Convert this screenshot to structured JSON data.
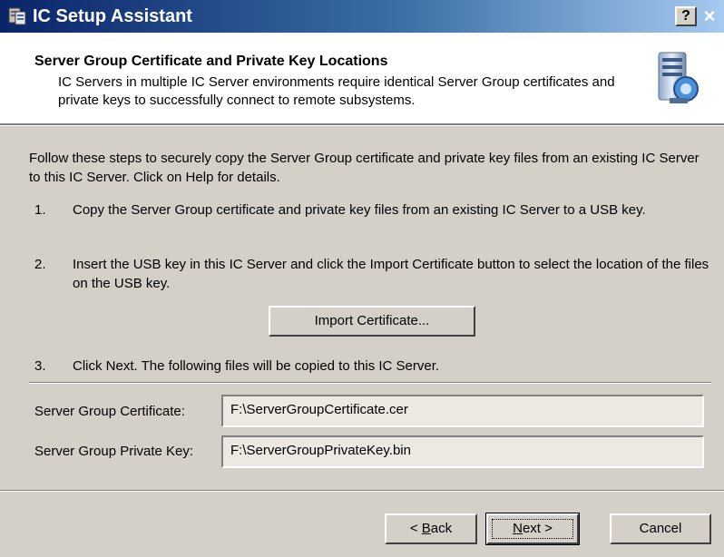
{
  "window": {
    "title": "IC Setup Assistant",
    "help_label": "?",
    "close_label": "×"
  },
  "banner": {
    "title": "Server Group Certificate and Private Key Locations",
    "description": "IC Servers in multiple IC Server environments require identical Server Group certificates and private keys to successfully connect to remote subsystems."
  },
  "content": {
    "intro": "Follow these steps to securely copy the Server Group certificate and private key files from an existing IC Server to this IC Server. Click on Help for details.",
    "steps": [
      {
        "number": "1.",
        "text": "Copy the Server Group certificate and private key files from an existing IC Server to a USB key."
      },
      {
        "number": "2.",
        "text": "Insert the USB key in this IC Server and click the Import Certificate button to select the location of the files on the USB key."
      },
      {
        "number": "3.",
        "text": "Click Next. The following files will be copied to this IC Server."
      }
    ],
    "import_button": "Import Certificate..."
  },
  "fields": {
    "certificate": {
      "label": "Server Group Certificate:",
      "value": "F:\\ServerGroupCertificate.cer"
    },
    "private_key": {
      "label": "Server Group Private Key:",
      "value": "F:\\ServerGroupPrivateKey.bin"
    }
  },
  "footer": {
    "back_prefix": "< ",
    "back_mnemonic": "B",
    "back_rest": "ack",
    "next_mnemonic": "N",
    "next_rest": "ext >",
    "cancel": "Cancel"
  },
  "colors": {
    "title_gradient_start": "#0a246a",
    "title_gradient_end": "#a6caf0",
    "dialog_face": "#d4d0c8",
    "banner_background": "#ffffff"
  }
}
